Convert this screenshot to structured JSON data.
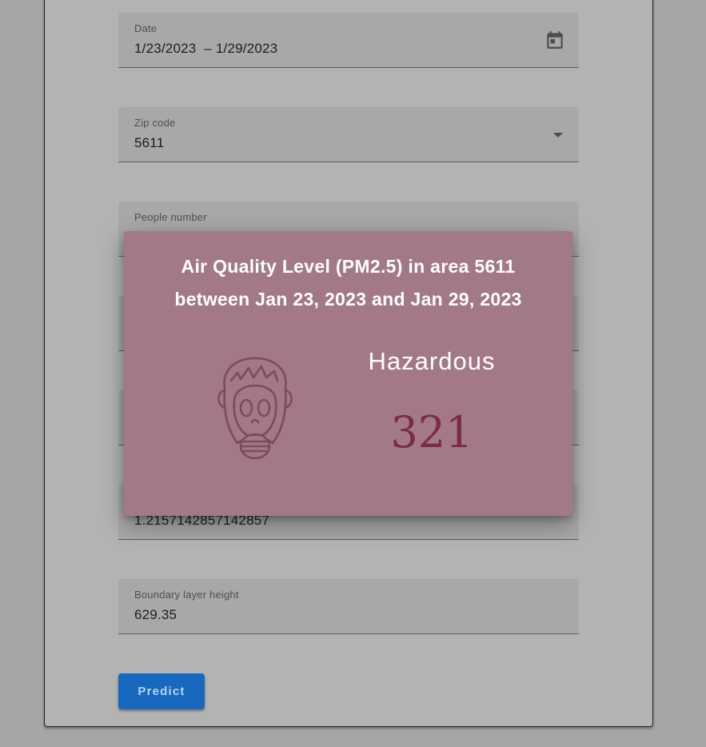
{
  "form": {
    "date": {
      "label": "Date",
      "value": "1/23/2023  – 1/29/2023"
    },
    "zip": {
      "label": "Zip code",
      "value": "5611"
    },
    "people": {
      "label": "People number",
      "value": ""
    },
    "hidden_field_value": "1.2157142857142857",
    "boundary": {
      "label": "Boundary layer height",
      "value": "629.35"
    },
    "predict_label": "Predict"
  },
  "modal": {
    "title_line1": "Air Quality Level (PM2.5) in area 5611",
    "title_line2": "between Jan 23, 2023 and Jan 29, 2023",
    "level": "Hazardous",
    "value": "321",
    "icon": "gas-mask-icon",
    "value_color": "#7b2a4c",
    "background_color": "#a37985"
  },
  "colors": {
    "accent": "#1769bf"
  }
}
